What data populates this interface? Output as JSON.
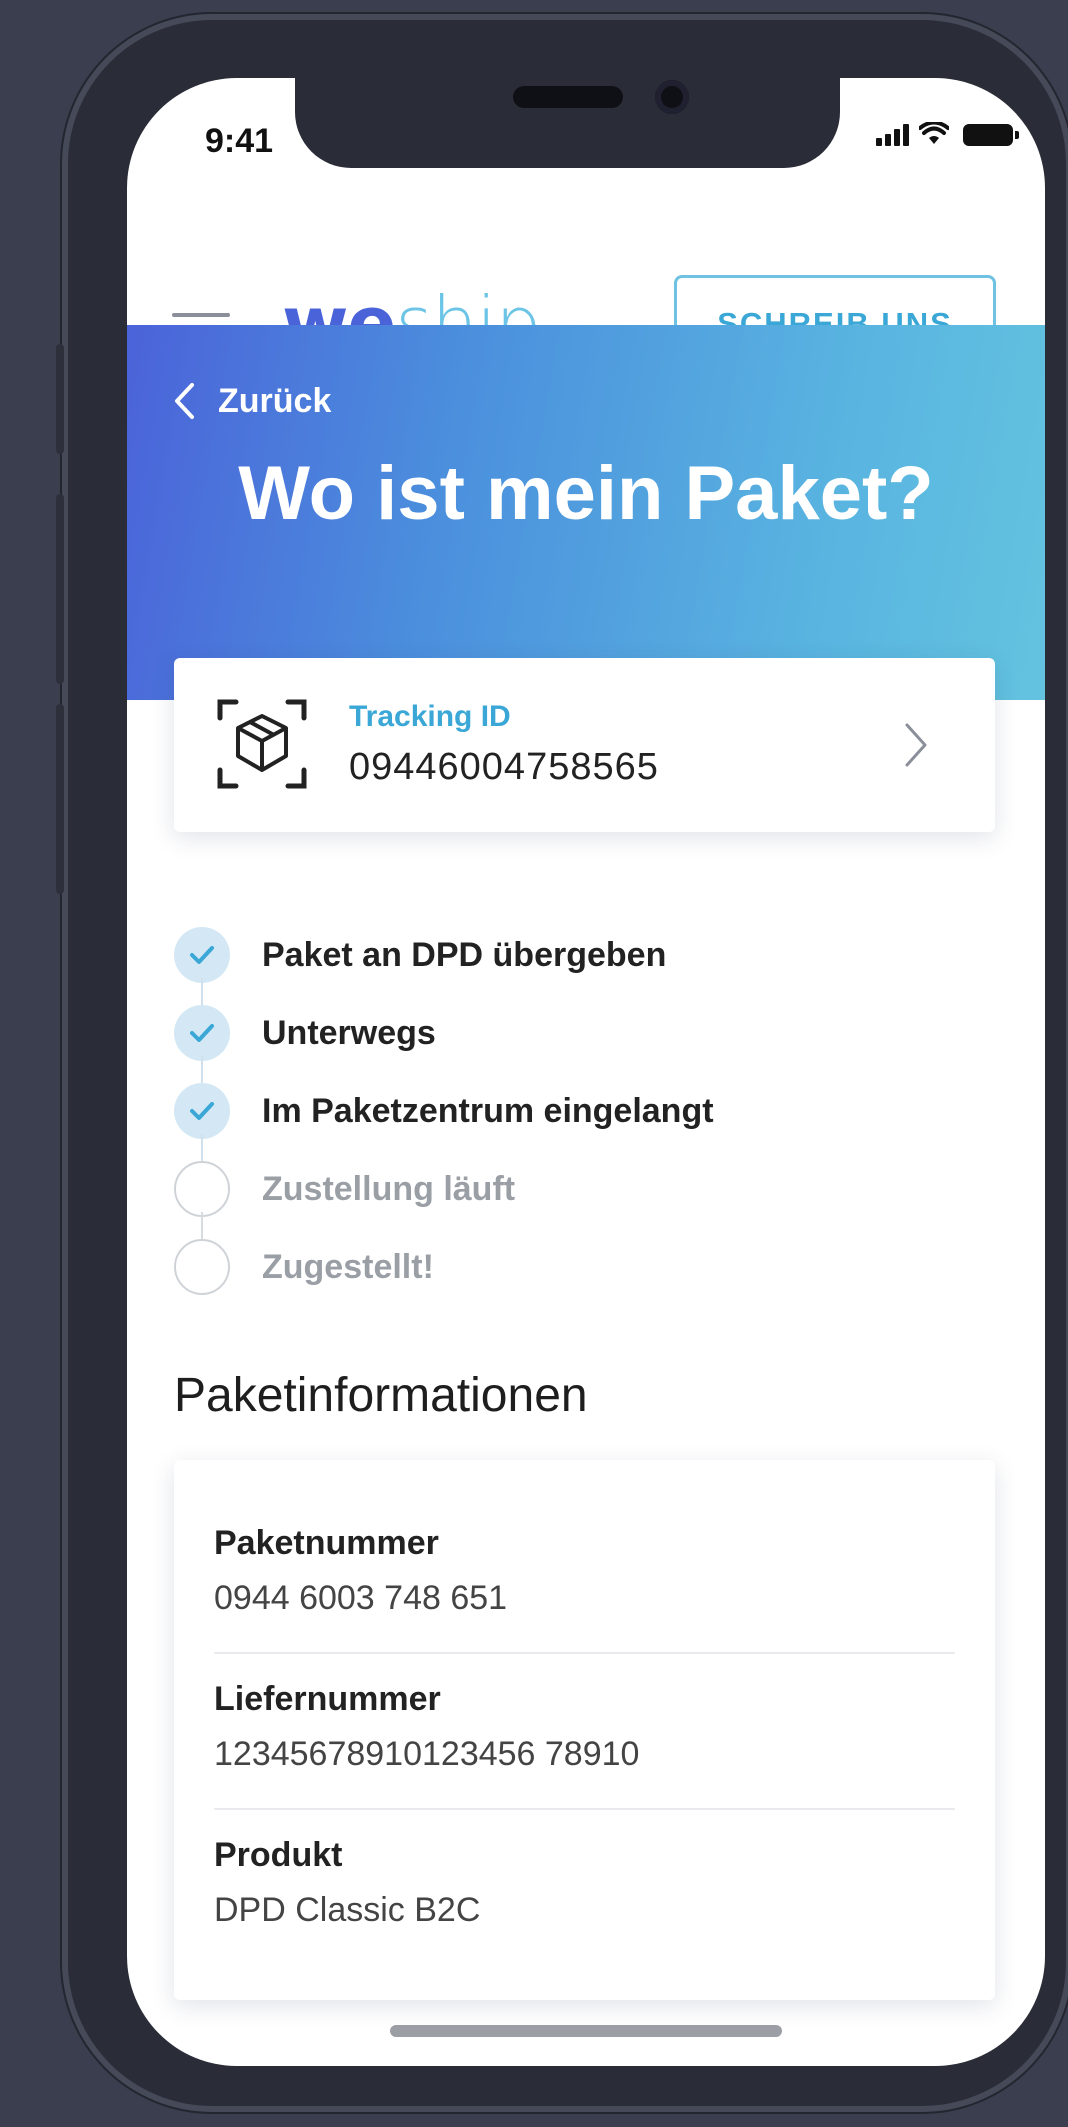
{
  "status_bar": {
    "time": "9:41"
  },
  "header": {
    "logo_we": "we",
    "logo_ship": "ship",
    "cta_label": "SCHREIB UNS"
  },
  "hero": {
    "back_label": "Zurück",
    "title": "Wo ist mein Paket?"
  },
  "tracking": {
    "label": "Tracking ID",
    "value": "09446004758565"
  },
  "timeline": {
    "steps": [
      {
        "label": "Paket an DPD übergeben",
        "done": true
      },
      {
        "label": "Unterwegs",
        "done": true
      },
      {
        "label": "Im Paketzentrum eingelangt",
        "done": true
      },
      {
        "label": "Zustellung läuft",
        "done": false
      },
      {
        "label": "Zugestellt!",
        "done": false
      }
    ]
  },
  "info": {
    "title": "Paketinformationen",
    "rows": [
      {
        "label": "Paketnummer",
        "value": "0944 6003 748 651"
      },
      {
        "label": "Liefernummer",
        "value": "12345678910123456 78910"
      },
      {
        "label": "Produkt",
        "value": "DPD Classic B2C"
      }
    ]
  },
  "colors": {
    "accent": "#3aa7d6",
    "brand_blue": "#4b63d9",
    "hero_gradient_end": "#63c3df",
    "step_done": "#d3e8f4"
  },
  "icons": [
    "hamburger-icon",
    "back-chevron-icon",
    "package-scan-icon",
    "chevron-right-icon",
    "check-icon"
  ]
}
